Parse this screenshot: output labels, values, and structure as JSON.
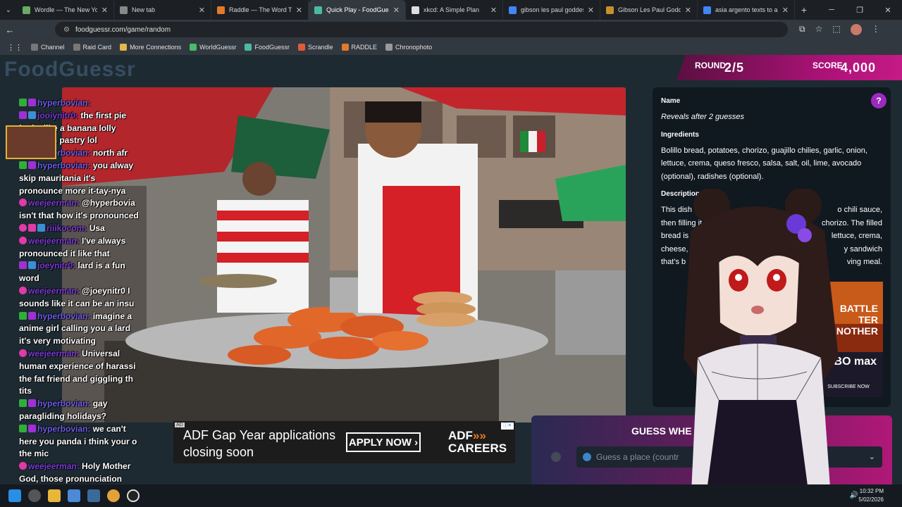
{
  "browser": {
    "tabs": [
      {
        "label": "Wordle — The New York",
        "color": "#6aaa64",
        "active": false
      },
      {
        "label": "New tab",
        "color": "#888888",
        "active": false
      },
      {
        "label": "Raddle — The Word Trans",
        "color": "#e07a2c",
        "active": false
      },
      {
        "label": "Quick Play - FoodGuessr",
        "color": "#4bbba0",
        "active": true
      },
      {
        "label": "xkcd: A Simple Plan",
        "color": "#dddddd",
        "active": false
      },
      {
        "label": "gibson les paul goddess",
        "color": "#4285f4",
        "active": false
      },
      {
        "label": "Gibson Les Paul Goddess",
        "color": "#c8902c",
        "active": false
      },
      {
        "label": "asia argento texts to anth",
        "color": "#4285f4",
        "active": false
      }
    ],
    "new_tab_label": "+",
    "url": "foodguessr.com/game/random",
    "bookmarks": [
      {
        "label": "Channel",
        "color": "#777777"
      },
      {
        "label": "Raid Card",
        "color": "#777777"
      },
      {
        "label": "More Connections",
        "color": "#e0b84c"
      },
      {
        "label": "WorldGuessr",
        "color": "#4bbb6a"
      },
      {
        "label": "FoodGuessr",
        "color": "#4bbba0"
      },
      {
        "label": "Scrandle",
        "color": "#e05a3a"
      },
      {
        "label": "RADDLE",
        "color": "#e07a2c"
      },
      {
        "label": "Chronophoto",
        "color": "#999999"
      }
    ]
  },
  "game": {
    "logo": "FoodGuessr",
    "round_label": "ROUND",
    "round_value": "2/5",
    "score_label": "SCORE",
    "score_value": "4,000",
    "help_icon": "?",
    "name_heading": "Name",
    "name_value": "Reveals after 2 guesses",
    "ingredients_heading": "Ingredients",
    "ingredients_value": "Bolillo bread, potatoes, chorizo, guajillo chilies, garlic, onion, lettuce, crema, queso fresco, salsa, salt, oil, lime, avocado (optional), radishes (optional).",
    "description_heading": "Description",
    "description_lines": [
      {
        "left": "This dish is",
        "right": "o chili sauce,"
      },
      {
        "left": "then filling it w",
        "right": "chorizo. The filled"
      },
      {
        "left": "bread is frie",
        "right": "lettuce, crema,"
      },
      {
        "left": "cheese, a",
        "right": "y sandwich"
      },
      {
        "left": "that's b",
        "right": "ving meal."
      }
    ],
    "guess_title": "GUESS WHE",
    "guess_placeholder": "Guess a place (countr"
  },
  "ads": {
    "tag": "AD",
    "adf_text_line1": "ADF Gap Year applications",
    "adf_text_line2": "closing soon",
    "adf_button": "APPLY NOW",
    "adf_brand_line1": "ADF",
    "adf_brand_line2": "CAREERS",
    "hbo_line1": "BATTLE",
    "hbo_line2": "TER",
    "hbo_line3": "ANOTHER",
    "hbo_brand": "HBO max",
    "hbo_subscribe": "SUBSCRIBE NOW"
  },
  "chat": [
    {
      "badges": [
        "mod",
        "sub"
      ],
      "user": "hyperbovian:",
      "text": ""
    },
    {
      "badges": [
        "sub",
        "vip"
      ],
      "user": "jooiynitr0:",
      "text": "the first pie looks like a banana lolly rapped in pastry lol"
    },
    {
      "badges": [
        "mod",
        "sub"
      ],
      "user": "hyperbovian:",
      "text": "north afr"
    },
    {
      "badges": [
        "mod",
        "sub"
      ],
      "user": "hyperbovian:",
      "text": "you alway skip mauritania it's pronounce more it-tay-nya"
    },
    {
      "badges": [
        "heart"
      ],
      "user": "weejeerman:",
      "text": "@hyperbovia isn't that how it's pronounced"
    },
    {
      "badges": [
        "heart",
        "star",
        "vip"
      ],
      "user": "riiikocom:",
      "text": "Usa"
    },
    {
      "badges": [
        "heart"
      ],
      "user": "weejeerman:",
      "text": "I've always pronounced it like that"
    },
    {
      "badges": [
        "sub",
        "vip"
      ],
      "user": "joeynitr0:",
      "text": "lard is a fun word"
    },
    {
      "badges": [
        "heart"
      ],
      "user": "weejeerman:",
      "text": "@joeynitr0 I sounds like it can be an insu"
    },
    {
      "badges": [
        "mod",
        "sub"
      ],
      "user": "hyperbovian:",
      "text": "imagine a anime girl calling you a lard it's very motivating"
    },
    {
      "badges": [
        "heart"
      ],
      "user": "weejeerman:",
      "text": "Universal human experience of harassi the fat friend and giggling th tits"
    },
    {
      "badges": [
        "mod",
        "sub"
      ],
      "user": "hyperbovian:",
      "text": "gay paragliding holidays?"
    },
    {
      "badges": [
        "mod",
        "sub"
      ],
      "user": "hyperbovian:",
      "text": "we can't here you panda i think your o the mic"
    },
    {
      "badges": [
        "heart"
      ],
      "user": "weejeerman:",
      "text": "Holy Mother God, those pronunciation"
    }
  ],
  "taskbar": {
    "time": "10:32 PM",
    "date": "5/02/2026"
  }
}
